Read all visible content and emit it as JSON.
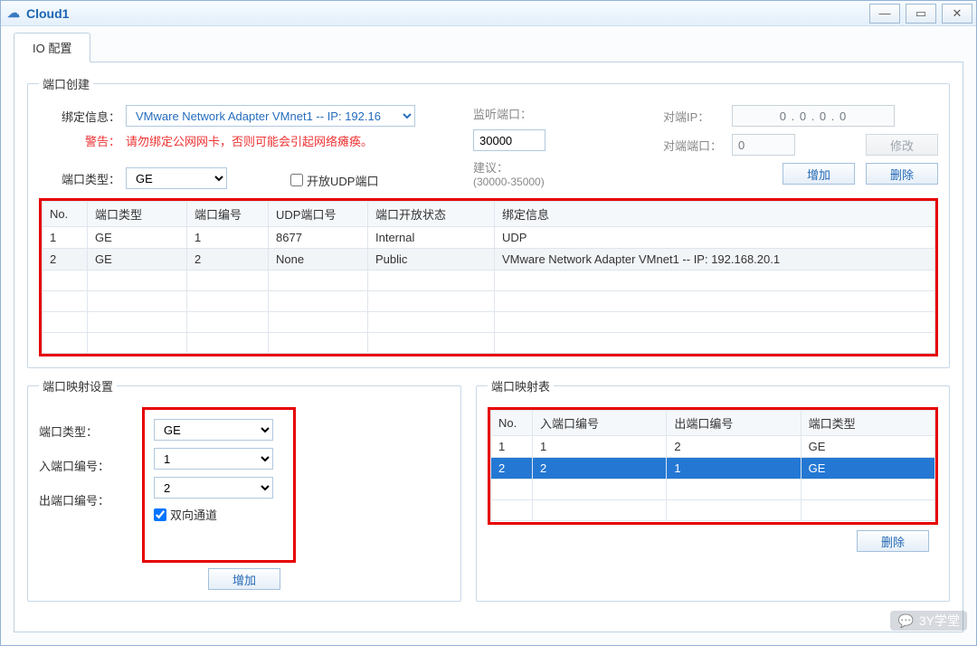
{
  "window": {
    "title": "Cloud1"
  },
  "tabs": {
    "io_config": "IO 配置"
  },
  "group_port_create": {
    "legend": "端口创建",
    "bind_label": "绑定信息：",
    "bind_value": "VMware Network Adapter VMnet1 -- IP: 192.16",
    "warn_label": "警告：",
    "warn_text": "请勿绑定公网网卡，否则可能会引起网络瘫痪。",
    "port_type_label": "端口类型：",
    "port_type_value": "GE",
    "open_udp_label": "开放UDP端口",
    "listen_port_label": "监听端口：",
    "listen_port_value": "30000",
    "advice_label": "建议：",
    "advice_range": "(30000-35000)",
    "peer_ip_label": "对端IP：",
    "peer_ip_value": "0   .   0   .   0   .   0",
    "peer_port_label": "对端端口：",
    "peer_port_value": "0",
    "btn_modify": "修改",
    "btn_add": "增加",
    "btn_delete": "删除",
    "table": {
      "headers": [
        "No.",
        "端口类型",
        "端口编号",
        "UDP端口号",
        "端口开放状态",
        "绑定信息"
      ],
      "rows": [
        {
          "no": "1",
          "type": "GE",
          "idx": "1",
          "udp": "8677",
          "state": "Internal",
          "bind": "UDP"
        },
        {
          "no": "2",
          "type": "GE",
          "idx": "2",
          "udp": "None",
          "state": "Public",
          "bind": "VMware Network Adapter VMnet1 -- IP: 192.168.20.1"
        }
      ]
    }
  },
  "group_port_map_cfg": {
    "legend": "端口映射设置",
    "port_type_label": "端口类型：",
    "port_type_value": "GE",
    "in_port_label": "入端口编号：",
    "in_port_value": "1",
    "out_port_label": "出端口编号：",
    "out_port_value": "2",
    "bidir_label": "双向通道",
    "btn_add": "增加"
  },
  "group_port_map_table": {
    "legend": "端口映射表",
    "headers": [
      "No.",
      "入端口编号",
      "出端口编号",
      "端口类型"
    ],
    "rows": [
      {
        "no": "1",
        "in": "1",
        "out": "2",
        "type": "GE",
        "selected": false
      },
      {
        "no": "2",
        "in": "2",
        "out": "1",
        "type": "GE",
        "selected": true
      }
    ],
    "btn_delete": "删除"
  },
  "watermark": "3Y学堂"
}
